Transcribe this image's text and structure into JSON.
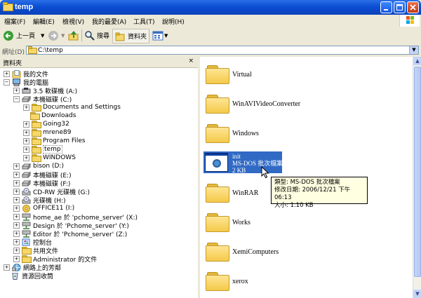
{
  "window": {
    "title": "temp"
  },
  "menu": [
    "檔案(F)",
    "編輯(E)",
    "檢視(V)",
    "我的最愛(A)",
    "工具(T)",
    "說明(H)"
  ],
  "toolbar": {
    "back": "上一頁",
    "search": "搜尋",
    "folders": "資料夾"
  },
  "address": {
    "label": "網址(D)",
    "value": "C:\\temp"
  },
  "left_pane": {
    "title": "資料夾",
    "close": "×"
  },
  "tree": [
    {
      "label": "我的文件",
      "icon": "my-documents-icon"
    },
    {
      "label": "我的電腦",
      "icon": "my-computer-icon"
    },
    {
      "label": "3.5 軟碟機 (A:)",
      "icon": "floppy-drive-icon"
    },
    {
      "label": "本機磁碟 (C:)",
      "icon": "hard-drive-icon"
    },
    {
      "label": "Documents and Settings",
      "icon": "folder-icon"
    },
    {
      "label": "Downloads",
      "icon": "folder-icon"
    },
    {
      "label": "Going32",
      "icon": "folder-icon"
    },
    {
      "label": "mrene89",
      "icon": "folder-icon"
    },
    {
      "label": "Program Files",
      "icon": "folder-icon"
    },
    {
      "label": "temp",
      "icon": "folder-open-icon"
    },
    {
      "label": "WINDOWS",
      "icon": "folder-icon"
    },
    {
      "label": "bison (D:)",
      "icon": "hard-drive-icon"
    },
    {
      "label": "本機磁碟 (E:)",
      "icon": "hard-drive-icon"
    },
    {
      "label": "本機磁碟 (F:)",
      "icon": "hard-drive-icon"
    },
    {
      "label": "CD-RW 光碟機 (G:)",
      "icon": "cd-drive-icon"
    },
    {
      "label": "光碟機 (H:)",
      "icon": "cd-drive-icon"
    },
    {
      "label": "OFFICE11 (I:)",
      "icon": "cd-drive-icon"
    },
    {
      "label": "home_ae 於 'pchome_server' (X:)",
      "icon": "network-drive-icon"
    },
    {
      "label": "Design 於 'Pchome_server' (Y:)",
      "icon": "network-drive-icon"
    },
    {
      "label": "Editor 於 'Pchome_server' (Z:)",
      "icon": "network-drive-icon"
    },
    {
      "label": "控制台",
      "icon": "control-panel-icon"
    },
    {
      "label": "共用文件",
      "icon": "folder-icon"
    },
    {
      "label": "Administrator 的文件",
      "icon": "folder-icon"
    },
    {
      "label": "網路上的芳鄰",
      "icon": "network-places-icon"
    },
    {
      "label": "資源回收筒",
      "icon": "recycle-bin-icon"
    }
  ],
  "files": [
    {
      "name": "Virtual"
    },
    {
      "name": "WinAVIVideoConverter"
    },
    {
      "name": "Windows"
    },
    {
      "name": "WinRAR"
    },
    {
      "name": "Works"
    },
    {
      "name": "XemiComputers"
    },
    {
      "name": "xerox"
    }
  ],
  "selected_file": {
    "name": "init",
    "type": "MS-DOS 批次檔案",
    "size": "2 KB"
  },
  "tooltip": {
    "type": "類型: MS-DOS 批次檔案",
    "modified": "修改日期: 2006/12/21 下午 06:13",
    "size": "大小: 1.10 KB"
  }
}
